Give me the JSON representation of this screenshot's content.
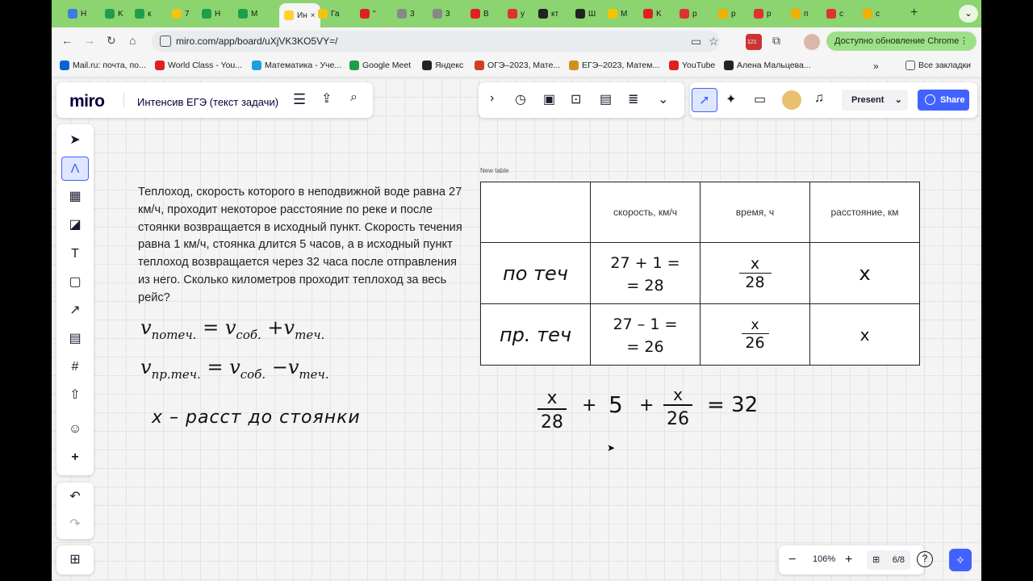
{
  "browser": {
    "tabs": [
      {
        "label": "H",
        "color": "#3e7be0"
      },
      {
        "label": "K",
        "color": "#1e9e4a"
      },
      {
        "label": "к",
        "color": "#1e9e4a"
      },
      {
        "label": "7",
        "color": "#f1c40f"
      },
      {
        "label": "H",
        "color": "#1e9e4a"
      },
      {
        "label": "M",
        "color": "#1e9e4a"
      },
      {
        "label": "Ин",
        "color": "#ffd02f",
        "active": true
      },
      {
        "label": "Га",
        "color": "#f1c40f"
      },
      {
        "label": "\"",
        "color": "#e02020"
      },
      {
        "label": "3",
        "color": "#888888"
      },
      {
        "label": "3",
        "color": "#888888"
      },
      {
        "label": "B",
        "color": "#e02020"
      },
      {
        "label": "y",
        "color": "#e03030"
      },
      {
        "label": "кт",
        "color": "#222222"
      },
      {
        "label": "Ш",
        "color": "#222222"
      },
      {
        "label": "M",
        "color": "#f5c400"
      },
      {
        "label": "K",
        "color": "#e02020"
      },
      {
        "label": "p",
        "color": "#e03030"
      },
      {
        "label": "p",
        "color": "#f1b000"
      },
      {
        "label": "p",
        "color": "#e03030"
      },
      {
        "label": "п",
        "color": "#f1b000"
      },
      {
        "label": "c",
        "color": "#e03030"
      },
      {
        "label": "c",
        "color": "#f1b000"
      }
    ],
    "url": "miro.com/app/board/uXjVK3KO5VY=/",
    "update_label": "Доступно обновление Chrome",
    "ext_badge": "121",
    "bookmarks": [
      {
        "label": "Mail.ru: почта, по...",
        "color": "#0a63d6"
      },
      {
        "label": "World Class - You...",
        "color": "#e02020"
      },
      {
        "label": "Математика - Уче...",
        "color": "#1aa0e0"
      },
      {
        "label": "Google Meet",
        "color": "#1e9e4a"
      },
      {
        "label": "Яндекс",
        "color": "#222222"
      },
      {
        "label": "ОГЭ–2023, Мате...",
        "color": "#d04020"
      },
      {
        "label": "ЕГЭ–2023, Матем...",
        "color": "#d09020"
      },
      {
        "label": "YouTube",
        "color": "#e02020"
      },
      {
        "label": "Алена Мальцева...",
        "color": "#222222"
      }
    ],
    "all_bookmarks": "Все закладки"
  },
  "miro": {
    "logo": "miro",
    "board_title": "Интенсив ЕГЭ (текст задачи)",
    "present_label": "Present",
    "share_label": "Share",
    "zoom": "106%",
    "pages": "6/8"
  },
  "problem_text": "Теплоход, скорость которого в неподвижной воде равна 27 км/ч, проходит некоторое расстояние по реке и после стоянки возвращается в исходный пункт. Скорость течения равна 1 км/ч, стоянка длится 5 часов, а в исходный пункт теплоход возвращается через 32 часа после отправления из него. Сколько километров проходит теплоход за весь рейс?",
  "formulas": [
    {
      "lhs": "v",
      "lhs_sub": "потеч.",
      "rhs1": "v",
      "rhs1_sub": "соб.",
      "op": "+",
      "rhs2": "v",
      "rhs2_sub": "теч."
    },
    {
      "lhs": "v",
      "lhs_sub": "пр.теч.",
      "rhs1": "v",
      "rhs1_sub": "соб.",
      "op": "−",
      "rhs2": "v",
      "rhs2_sub": "теч."
    }
  ],
  "handwritten_note": "x – расст до стоянки",
  "table": {
    "label": "New table",
    "headers": [
      "",
      "скорость, км/ч",
      "время, ч",
      "расстояние, км"
    ],
    "rows": [
      {
        "name": "по теч",
        "speed_line1": "27 + 1 =",
        "speed_line2": "= 28",
        "time_num": "x",
        "time_den": "28",
        "distance": "x"
      },
      {
        "name": "пр. теч",
        "speed_line1": "27 – 1 =",
        "speed_line2": "= 26",
        "time_num": "x",
        "time_den": "26",
        "distance": "x"
      }
    ]
  },
  "equation": {
    "n1": "x",
    "d1": "28",
    "plus1": "+",
    "five": "5",
    "plus2": "+",
    "n2": "x",
    "d2": "26",
    "eq": "= 32"
  }
}
